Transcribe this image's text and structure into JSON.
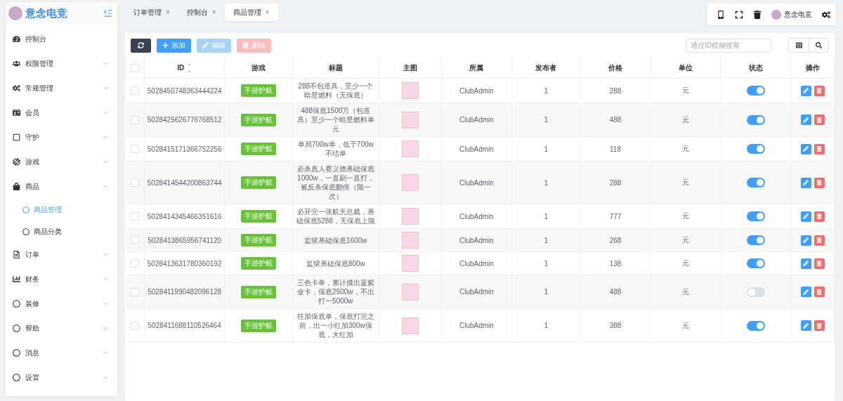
{
  "brand": {
    "name": "意念电竞"
  },
  "sidebar": {
    "items": [
      {
        "label": "控制台"
      },
      {
        "label": "权限管理",
        "expanded": false
      },
      {
        "label": "常规管理",
        "expanded": false
      },
      {
        "label": "会员",
        "expanded": false
      },
      {
        "label": "守护",
        "expanded": false
      },
      {
        "label": "游戏",
        "expanded": false
      },
      {
        "label": "商品",
        "expanded": true,
        "children": [
          {
            "label": "商品管理",
            "selected": true
          },
          {
            "label": "商品分类",
            "selected": false
          }
        ]
      },
      {
        "label": "订单",
        "expanded": false
      },
      {
        "label": "财务",
        "expanded": false
      },
      {
        "label": "装修",
        "expanded": false
      },
      {
        "label": "帮助",
        "expanded": false
      },
      {
        "label": "消息",
        "expanded": false
      },
      {
        "label": "设置",
        "expanded": false
      }
    ]
  },
  "tabs": [
    {
      "label": "订单管理",
      "close": "×",
      "selected": false
    },
    {
      "label": "控制台",
      "close": "×",
      "selected": false
    },
    {
      "label": "商品管理",
      "close": "×",
      "selected": true
    }
  ],
  "topbar": {
    "user": "意念电竞"
  },
  "toolbar": {
    "buttons": [
      {
        "kind": "refresh",
        "disabled": false
      },
      {
        "kind": "add",
        "label": "添加",
        "disabled": false
      },
      {
        "kind": "edit",
        "label": "编辑",
        "disabled": true
      },
      {
        "kind": "delete",
        "label": "删除",
        "disabled": true
      }
    ],
    "search": {
      "placeholder": "通过ID模糊搜索"
    }
  },
  "table": {
    "all_checked": false,
    "columns": [
      "ID",
      "游戏",
      "标题",
      "主图",
      "所属",
      "发布者",
      "价格",
      "单位",
      "状态",
      "操作"
    ],
    "rows": [
      {
        "checked": false,
        "id": "5028450748363444224",
        "game": "手游护航",
        "title": "288不包道具，至少一个暗星燃料（无保底）",
        "owner": "ClubAdmin",
        "publisher": "1",
        "price": "288",
        "unit": "元",
        "on": true
      },
      {
        "checked": false,
        "id": "5028425626776768512",
        "game": "手游护航",
        "title": "488保底1500万（包道具）至少一个暗星燃料单元",
        "owner": "ClubAdmin",
        "publisher": "1",
        "price": "488",
        "unit": "元",
        "on": true
      },
      {
        "checked": false,
        "id": "5028415171366752256",
        "game": "手游护航",
        "title": "单局700w单，低于700w不结单",
        "owner": "ClubAdmin",
        "publisher": "1",
        "price": "118",
        "unit": "元",
        "on": true
      },
      {
        "checked": false,
        "id": "5028414544200863744",
        "game": "手游护航",
        "title": "必杀真人赛义德基础保底1000w，一直刷一直打，被反杀保底翻倍（限一次）",
        "owner": "ClubAdmin",
        "publisher": "1",
        "price": "288",
        "unit": "元",
        "on": true
      },
      {
        "checked": false,
        "id": "5028414345466351616",
        "game": "手游护航",
        "title": "必开完一张航天总裁，基础保底5288，无保底上限",
        "owner": "ClubAdmin",
        "publisher": "1",
        "price": "777",
        "unit": "元",
        "on": true
      },
      {
        "checked": false,
        "id": "5028413865956741120",
        "game": "手游护航",
        "title": "监狱基础保底1600w",
        "owner": "ClubAdmin",
        "publisher": "1",
        "price": "268",
        "unit": "元",
        "on": true
      },
      {
        "checked": false,
        "id": "5028413631780360192",
        "game": "手游护航",
        "title": "监狱基础保底800w",
        "owner": "ClubAdmin",
        "publisher": "1",
        "price": "138",
        "unit": "元",
        "on": true
      },
      {
        "checked": false,
        "id": "5028411990482096128",
        "game": "手游护航",
        "title": "三色卡单，累计摸出蓝紫金卡，保底2500w，不出打一5000w",
        "owner": "ClubAdmin",
        "publisher": "1",
        "price": "488",
        "unit": "元",
        "on": false
      },
      {
        "checked": false,
        "id": "5028411688110526464",
        "game": "手游护航",
        "title": "狂加保底单，保底打完之前，出一小红加300w保底，大红加",
        "owner": "ClubAdmin",
        "publisher": "1",
        "price": "388",
        "unit": "元",
        "on": true
      }
    ]
  }
}
